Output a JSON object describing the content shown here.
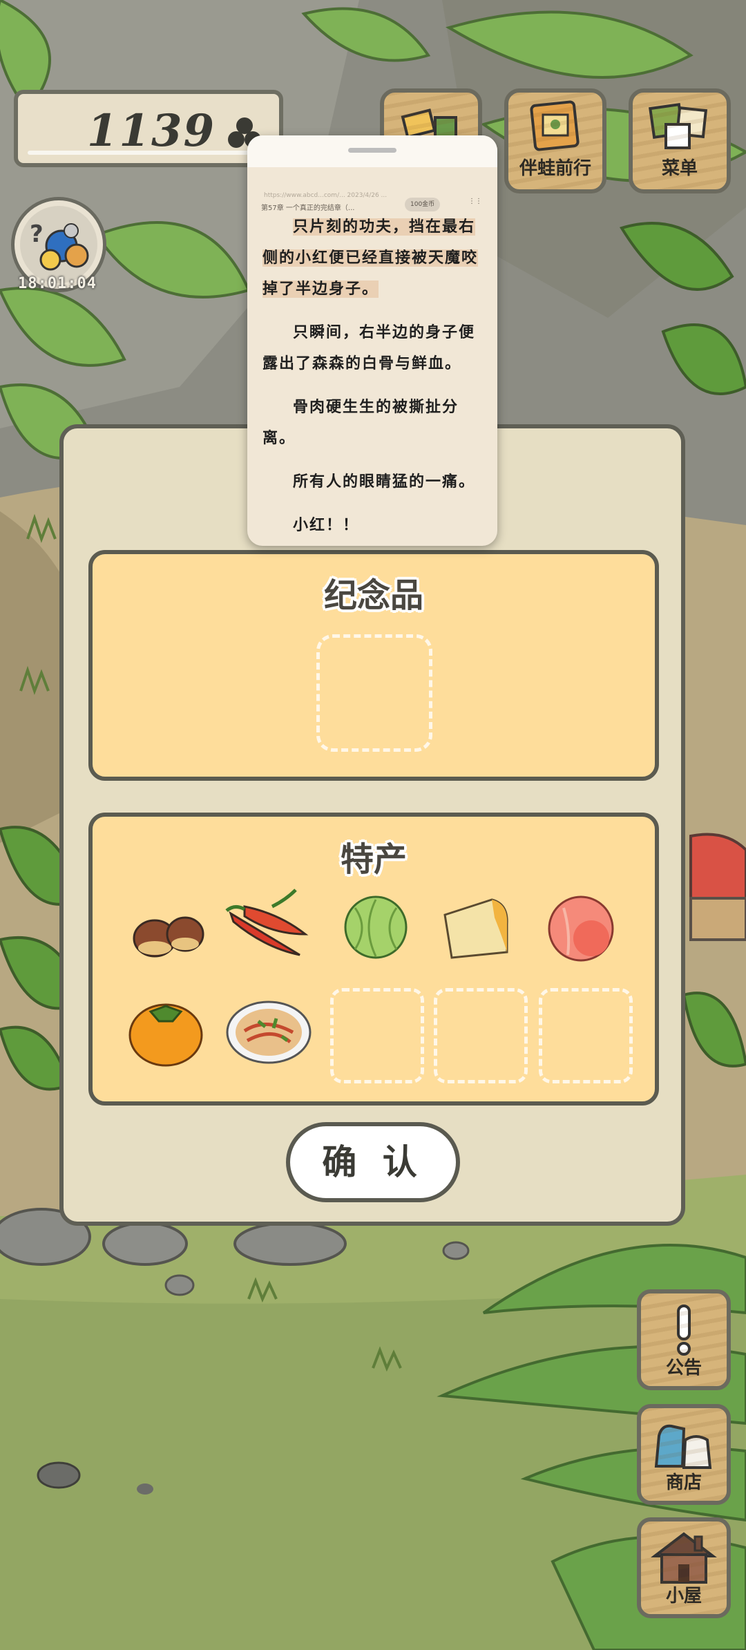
{
  "hud": {
    "clover_count": "1139",
    "frog_timer": "18:01:04"
  },
  "top_buttons": [
    {
      "label": "伴蛙前行",
      "icon": "frog-album-icon"
    },
    {
      "label": "菜单",
      "icon": "menu-icon"
    }
  ],
  "side_buttons": [
    {
      "label": "公告",
      "icon": "exclamation-icon"
    },
    {
      "label": "商店",
      "icon": "shop-bag-icon"
    },
    {
      "label": "小屋",
      "icon": "house-icon"
    }
  ],
  "reader": {
    "url": "https://www.abcd...com/... 2023/4/26 ...",
    "chapter": "第57章 一个真正的完结章（...",
    "chip": "100金币",
    "paragraphs": [
      "只片刻的功夫，挡在最右侧的小红便已经直接被天魔咬掉了半边身子。",
      "只瞬间，右半边的身子便露出了森森的白骨与鲜血。",
      "骨肉硬生生的被撕扯分离。",
      "所有人的眼睛猛的一痛。",
      "小红！！"
    ]
  },
  "dialog": {
    "souvenir_title": "纪念品",
    "specialty_title": "特产",
    "specialty_items": [
      "chestnuts-icon",
      "chili-peppers-icon",
      "cabbage-icon",
      "cheese-icon",
      "peach-icon",
      "persimmon-icon",
      "noodle-dish-icon"
    ],
    "empty_slots": 3,
    "confirm_label": "确 认"
  },
  "colors": {
    "panel_fill": "#fedd9b",
    "dialog_fill": "#e6dec3",
    "border": "#5b5b50",
    "wood": "#d6b47a"
  }
}
